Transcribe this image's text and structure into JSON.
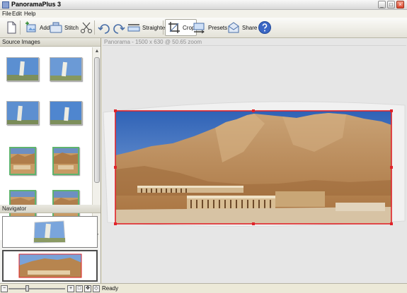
{
  "window": {
    "title": "PanoramaPlus 3",
    "min_glyph": "_",
    "max_glyph": "□",
    "close_glyph": "×"
  },
  "menu": [
    "File",
    "Edit",
    "Help"
  ],
  "toolbar": {
    "add_label": "Add",
    "stitch_label": "Stitch",
    "straighten_label": "Straighten",
    "crop_label": "Crop",
    "presets_label": "Presets",
    "share_label": "Share"
  },
  "source_panel": {
    "title": "Source Images"
  },
  "navigator_panel": {
    "title": "Navigator"
  },
  "canvas": {
    "info": "Panorama - 1500 x 630 @ 50.65 zoom"
  },
  "status": {
    "text": "Ready"
  },
  "colors": {
    "crop_frame": "#e0232a",
    "used_thumb_border": "#5fb36e",
    "accent": "#3a66c4"
  }
}
